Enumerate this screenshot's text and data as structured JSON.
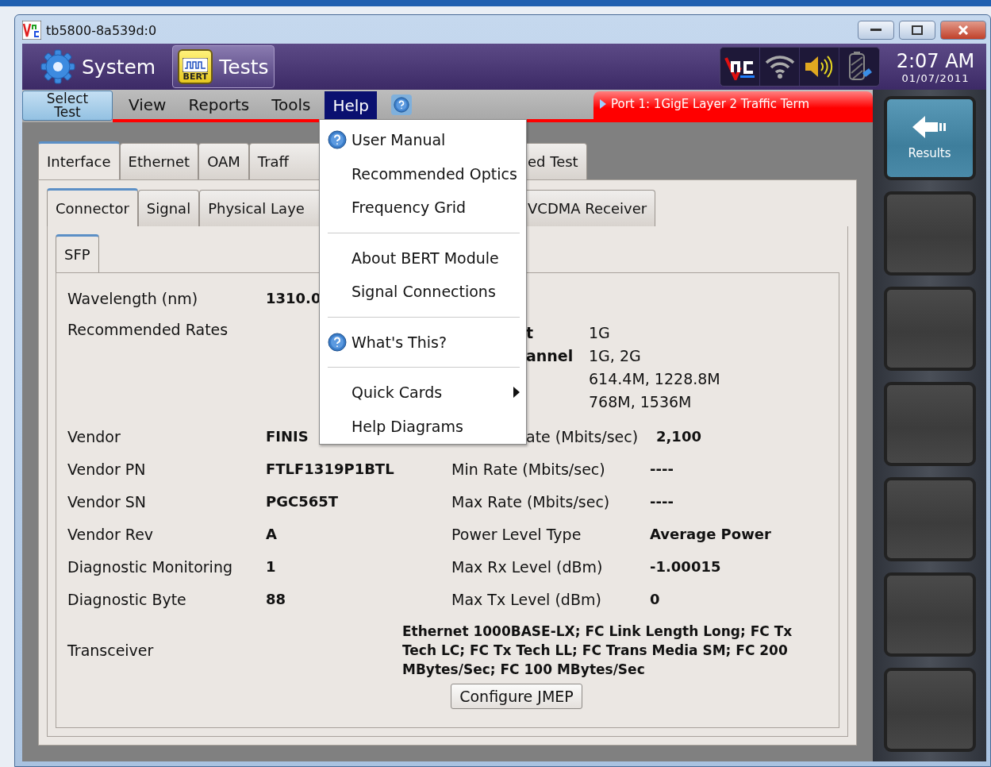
{
  "window": {
    "title": "tb5800-8a539d:0"
  },
  "top_bar": {
    "buttons": [
      {
        "kind": "system",
        "label": "System",
        "selected": false
      },
      {
        "kind": "tests",
        "label": "Tests",
        "icon_label": "BERT",
        "selected": true
      }
    ],
    "time": "2:07 AM",
    "date": "01/07/2011"
  },
  "menu_bar": {
    "select_test": "Select Test",
    "items": [
      {
        "label": "View",
        "selected": false
      },
      {
        "label": "Reports",
        "selected": false
      },
      {
        "label": "Tools",
        "selected": false
      },
      {
        "label": "Help",
        "selected": true
      }
    ]
  },
  "status_banner": "Port 1: 1GigE Layer 2 Traffic Term",
  "tabs": [
    {
      "label": "Interface",
      "selected": true,
      "kind": "full"
    },
    {
      "label": "Ethernet",
      "selected": false,
      "kind": "full"
    },
    {
      "label": "OAM",
      "selected": false,
      "kind": "full"
    },
    {
      "label": "Traff",
      "selected": false,
      "kind": "under_menu"
    },
    {
      "label": "ed Test",
      "selected": false,
      "kind": "past_menu"
    }
  ],
  "subtabs": [
    {
      "label": "Connector",
      "selected": true,
      "kind": "full"
    },
    {
      "label": "Signal",
      "selected": false,
      "kind": "full"
    },
    {
      "label": "Physical Laye",
      "selected": false,
      "kind": "under_menu"
    },
    {
      "label": "VCDMA Receiver",
      "selected": false,
      "kind": "past_menu"
    }
  ],
  "inner_tabs": [
    {
      "label": "SFP",
      "selected": true
    }
  ],
  "fields": [
    {
      "kind": "single",
      "label": "Wavelength (nm)",
      "value": "1310.0"
    },
    {
      "kind": "rates",
      "label": "Recommended Rates",
      "rates": [
        {
          "label": "t",
          "value": "1G"
        },
        {
          "label": "annel",
          "value": "1G, 2G"
        },
        {
          "value": "614.4M, 1228.8M"
        },
        {
          "value": "768M, 1536M"
        }
      ]
    },
    {
      "kind": "double_cut",
      "label": "Vendor",
      "value": "FINIS",
      "right_label": "ate (Mbits/sec)",
      "right_value": "2,100"
    },
    {
      "kind": "double",
      "label": "Vendor PN",
      "value": "FTLF1319P1BTL",
      "right_label": "Min Rate (Mbits/sec)",
      "right_value": "----"
    },
    {
      "kind": "double",
      "label": "Vendor SN",
      "value": "PGC565T",
      "right_label": "Max Rate (Mbits/sec)",
      "right_value": "----"
    },
    {
      "kind": "double",
      "label": "Vendor Rev",
      "value": "A",
      "right_label": "Power Level Type",
      "right_value": "Average Power"
    },
    {
      "kind": "double",
      "label": "Diagnostic Monitoring",
      "value": "1",
      "right_label": "Max Rx Level (dBm)",
      "right_value": "-1.00015"
    },
    {
      "kind": "double",
      "label": "Diagnostic Byte",
      "value": "88",
      "right_label": "Max Tx Level (dBm)",
      "right_value": "0"
    },
    {
      "kind": "long",
      "label": "Transceiver",
      "value": "Ethernet 1000BASE-LX; FC Link Length Long; FC Tx Tech LC; FC Tx Tech LL; FC Trans Media SM; FC 200 MBytes/Sec; FC 100 MBytes/Sec"
    }
  ],
  "configure_button": "Configure JMEP",
  "help_menu": {
    "groups": [
      [
        {
          "label": "User Manual",
          "icon": true,
          "submenu": false
        },
        {
          "label": "Recommended Optics",
          "icon": false,
          "submenu": false
        },
        {
          "label": "Frequency Grid",
          "icon": false,
          "submenu": false
        }
      ],
      [
        {
          "label": "About BERT Module",
          "icon": false,
          "submenu": false
        },
        {
          "label": "Signal Connections",
          "icon": false,
          "submenu": false
        }
      ],
      [
        {
          "label": "What's This?",
          "icon": true,
          "submenu": false
        }
      ],
      [
        {
          "label": "Quick Cards",
          "icon": false,
          "submenu": true
        },
        {
          "label": "Help Diagrams",
          "icon": false,
          "submenu": false
        }
      ]
    ]
  },
  "soft_keys": [
    {
      "kind": "results",
      "label": "Results"
    },
    {
      "kind": "blank"
    },
    {
      "kind": "blank"
    },
    {
      "kind": "blank"
    },
    {
      "kind": "blank"
    },
    {
      "kind": "blank"
    },
    {
      "kind": "blank"
    }
  ]
}
